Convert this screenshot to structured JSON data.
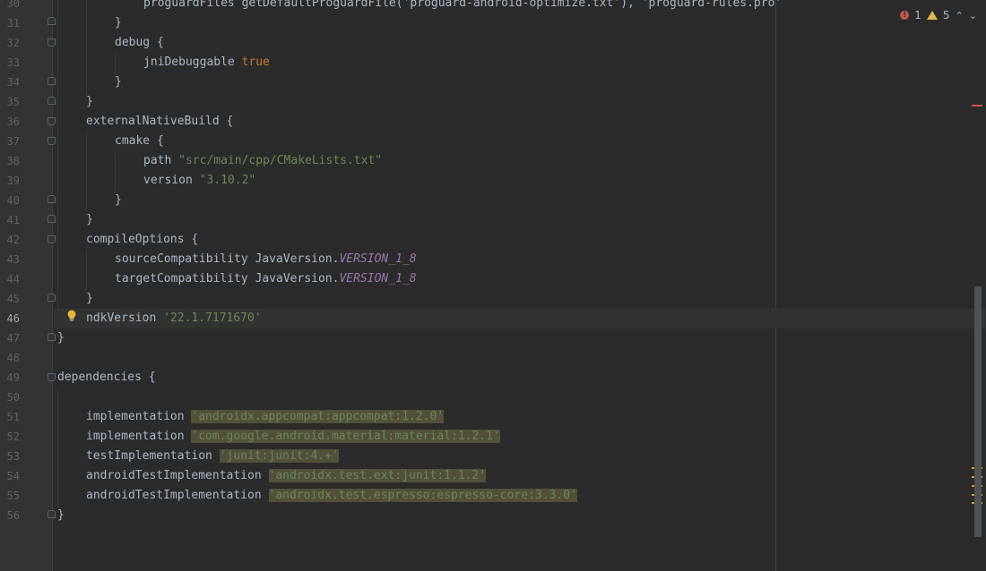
{
  "gutter": {
    "line_numbers": [
      "30",
      "31",
      "32",
      "33",
      "34",
      "35",
      "36",
      "37",
      "38",
      "39",
      "40",
      "41",
      "42",
      "43",
      "44",
      "45",
      "46",
      "47",
      "48",
      "49",
      "50",
      "51",
      "52",
      "53",
      "54",
      "55",
      "56"
    ],
    "active_line": "46"
  },
  "code": {
    "l30": "proguardFiles getDefaultProguardFile('proguard-android-optimize.txt'), 'proguard-rules.pro'",
    "l31": "}",
    "l32": "debug {",
    "l33_a": "jniDebuggable ",
    "l33_b": "true",
    "l34": "}",
    "l35": "}",
    "l36": "externalNativeBuild {",
    "l37": "cmake {",
    "l38_a": "path ",
    "l38_b": "\"src/main/cpp/CMakeLists.txt\"",
    "l39_a": "version ",
    "l39_b": "\"3.10.2\"",
    "l40": "}",
    "l41": "}",
    "l42": "compileOptions {",
    "l43_a": "sourceCompatibility JavaVersion.",
    "l43_b": "VERSION_1_8",
    "l44_a": "targetCompatibility JavaVersion.",
    "l44_b": "VERSION_1_8",
    "l45": "}",
    "l46_a": "ndkVersion ",
    "l46_b": "'22.1.7171670'",
    "l47": "}",
    "l49": "dependencies {",
    "l51_a": "implementation ",
    "l51_b": "'androidx.appcompat:appcompat:1.2.0'",
    "l52_a": "implementation ",
    "l52_b": "'com.google.android.material:material:1.2.1'",
    "l53_a": "testImplementation ",
    "l53_b": "'junit:junit:4.+'",
    "l54_a": "androidTestImplementation ",
    "l54_b": "'androidx.test.ext:junit:1.1.2'",
    "l55_a": "androidTestImplementation ",
    "l55_b": "'androidx.test.espresso:espresso-core:3.3.0'",
    "l56": "}"
  },
  "inspection": {
    "errors": "1",
    "warnings": "5",
    "up_icon": "chevron-up-icon",
    "down_icon": "chevron-down-icon"
  },
  "colors": {
    "background": "#2b2b2b",
    "keyword": "#cc7832",
    "string": "#6a8759",
    "error": "#c75450",
    "warning": "#e0b74e"
  }
}
